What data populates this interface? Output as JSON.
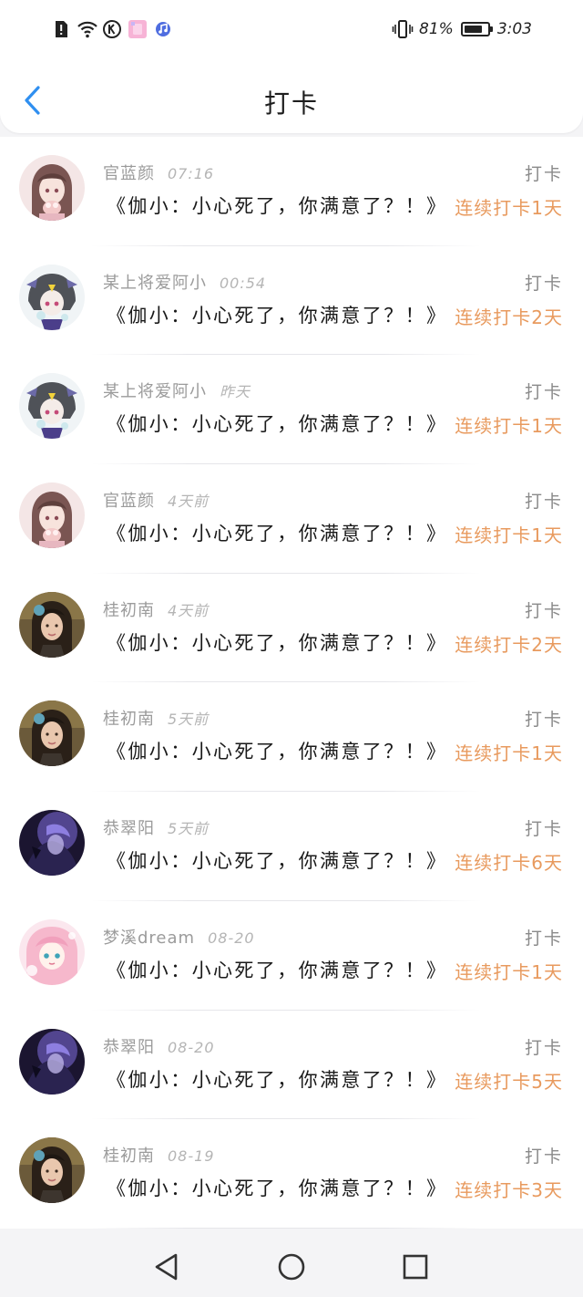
{
  "status_bar": {
    "battery_percent": "81%",
    "battery_level": 0.81,
    "time": "3:03",
    "icons": [
      "alert-icon",
      "wifi-icon",
      "k-app-icon",
      "gallery-app-icon",
      "music-app-icon",
      "vibrate-icon",
      "battery-icon"
    ]
  },
  "header": {
    "back_icon": "chevron-left-icon",
    "title": "打卡"
  },
  "colors": {
    "accent_blue": "#2f8ff0",
    "streak_orange": "#e89a5e",
    "muted_gray": "#9b9b9b"
  },
  "feed": [
    {
      "user": "官蓝颜",
      "time": "07:16",
      "tag": "打卡",
      "quote": "《伽小：小心死了，你满意了？！》",
      "streak": "连续打卡1天",
      "avatar": "avatar-anime-girl-pink"
    },
    {
      "user": "某上将爱阿小",
      "time": "00:54",
      "tag": "打卡",
      "quote": "《伽小：小心死了，你满意了？！》",
      "streak": "连续打卡2天",
      "avatar": "avatar-anime-gray-hair"
    },
    {
      "user": "某上将爱阿小",
      "time": "昨天",
      "tag": "打卡",
      "quote": "《伽小：小心死了，你满意了？！》",
      "streak": "连续打卡1天",
      "avatar": "avatar-anime-gray-hair"
    },
    {
      "user": "官蓝颜",
      "time": "4天前",
      "tag": "打卡",
      "quote": "《伽小：小心死了，你满意了？！》",
      "streak": "连续打卡1天",
      "avatar": "avatar-anime-girl-pink"
    },
    {
      "user": "桂初南",
      "time": "4天前",
      "tag": "打卡",
      "quote": "《伽小：小心死了，你满意了？！》",
      "streak": "连续打卡2天",
      "avatar": "avatar-photo-girl"
    },
    {
      "user": "桂初南",
      "time": "5天前",
      "tag": "打卡",
      "quote": "《伽小：小心死了，你满意了？！》",
      "streak": "连续打卡1天",
      "avatar": "avatar-photo-girl"
    },
    {
      "user": "恭翠阳",
      "time": "5天前",
      "tag": "打卡",
      "quote": "《伽小：小心死了，你满意了？！》",
      "streak": "连续打卡6天",
      "avatar": "avatar-dark-purple"
    },
    {
      "user": "梦溪dream",
      "time": "08-20",
      "tag": "打卡",
      "quote": "《伽小：小心死了，你满意了？！》",
      "streak": "连续打卡1天",
      "avatar": "avatar-anime-pink-hair"
    },
    {
      "user": "恭翠阳",
      "time": "08-20",
      "tag": "打卡",
      "quote": "《伽小：小心死了，你满意了？！》",
      "streak": "连续打卡5天",
      "avatar": "avatar-dark-purple"
    },
    {
      "user": "桂初南",
      "time": "08-19",
      "tag": "打卡",
      "quote": "《伽小：小心死了，你满意了？！》",
      "streak": "连续打卡3天",
      "avatar": "avatar-photo-girl"
    }
  ],
  "system_nav": {
    "back": "triangle-back-icon",
    "home": "circle-home-icon",
    "recents": "square-recents-icon"
  }
}
